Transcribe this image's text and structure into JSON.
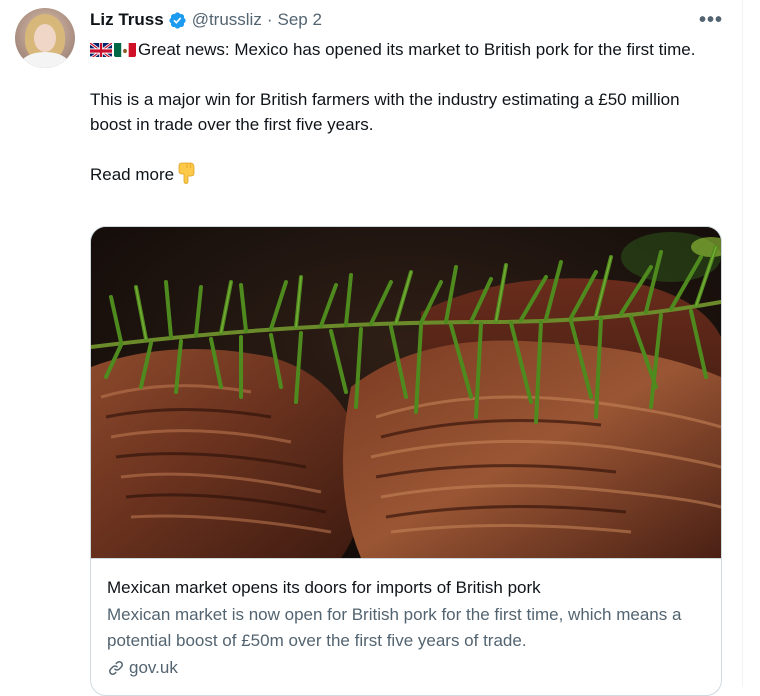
{
  "author": {
    "name": "Liz Truss",
    "handle": "@trussliz",
    "separator": "·",
    "date": "Sep 2",
    "verified": true
  },
  "menu": {
    "more_label": "•••"
  },
  "tweet": {
    "line1": "Great news: Mexico has opened its market to British pork for the first time.",
    "line2": "This is a major win for British farmers with the industry estimating a £50 million boost in trade over the first five years.",
    "line3": "Read more"
  },
  "card": {
    "title": "Mexican market opens its doors for imports of British pork",
    "description": "Mexican market is now open for British pork for the first time, which means a potential boost of £50m over the first five years of trade.",
    "domain": "gov.uk"
  },
  "icons": {
    "flag_uk": "uk-flag-icon",
    "flag_mexico": "mexico-flag-icon",
    "pointing": "backhand-index-pointing-down-icon",
    "verified": "verified-badge-icon",
    "link": "link-icon"
  },
  "colors": {
    "verified": "#1d9bf0",
    "text": "#0f1419",
    "muted": "#536471",
    "border": "#cfd9de"
  }
}
